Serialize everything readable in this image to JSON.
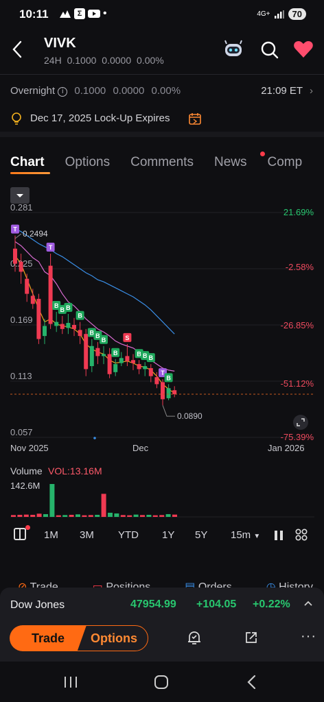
{
  "status": {
    "time": "10:11",
    "network": "4G+",
    "battery": "70"
  },
  "header": {
    "ticker": "VIVK",
    "sub_label": "24H",
    "sub_price": "0.1000",
    "sub_change": "0.0000",
    "sub_pct": "0.00%"
  },
  "overnight": {
    "label": "Overnight",
    "price": "0.1000",
    "change": "0.0000",
    "pct": "0.00%",
    "time": "21:09 ET"
  },
  "lockup": {
    "text": "Dec 17, 2025 Lock-Up Expires"
  },
  "tabs": [
    "Chart",
    "Options",
    "Comments",
    "News",
    "Comp"
  ],
  "chart": {
    "y_labels": [
      "0.281",
      "0.225",
      "0.169",
      "0.113",
      "0.057"
    ],
    "pct_labels": [
      "21.69%",
      "-2.58%",
      "-26.85%",
      "-51.12%",
      "-75.39%"
    ],
    "x_labels": [
      "Nov 2025",
      "Dec",
      "Jan 2026"
    ],
    "high_marker": "0.2494",
    "low_marker": "0.0890",
    "volume_label": "Volume",
    "volume_value": "VOL:13.16M",
    "volume_max": "142.6M",
    "colors": {
      "up": "#26b36b",
      "down": "#ef3a52",
      "ma1": "#f0a020",
      "ma2": "#d86bd0",
      "ma3": "#3a8ee6"
    }
  },
  "chart_data": {
    "type": "candlestick",
    "ylim": [
      0.057,
      0.281
    ],
    "ma_legend": [],
    "candles": [
      {
        "o": 0.245,
        "c": 0.23,
        "h": 0.258,
        "l": 0.222
      },
      {
        "o": 0.232,
        "c": 0.222,
        "h": 0.24,
        "l": 0.21
      },
      {
        "o": 0.215,
        "c": 0.2,
        "h": 0.22,
        "l": 0.192
      },
      {
        "o": 0.198,
        "c": 0.19,
        "h": 0.205,
        "l": 0.185
      },
      {
        "o": 0.195,
        "c": 0.155,
        "h": 0.2,
        "l": 0.15
      },
      {
        "o": 0.158,
        "c": 0.168,
        "h": 0.175,
        "l": 0.15
      },
      {
        "o": 0.228,
        "c": 0.17,
        "h": 0.24,
        "l": 0.165
      },
      {
        "o": 0.168,
        "c": 0.172,
        "h": 0.182,
        "l": 0.162
      },
      {
        "o": 0.17,
        "c": 0.165,
        "h": 0.178,
        "l": 0.16
      },
      {
        "o": 0.166,
        "c": 0.171,
        "h": 0.18,
        "l": 0.16
      },
      {
        "o": 0.169,
        "c": 0.165,
        "h": 0.176,
        "l": 0.158
      },
      {
        "o": 0.164,
        "c": 0.158,
        "h": 0.172,
        "l": 0.15
      },
      {
        "o": 0.16,
        "c": 0.125,
        "h": 0.165,
        "l": 0.118
      },
      {
        "o": 0.128,
        "c": 0.148,
        "h": 0.155,
        "l": 0.122
      },
      {
        "o": 0.146,
        "c": 0.138,
        "h": 0.152,
        "l": 0.13
      },
      {
        "o": 0.138,
        "c": 0.14,
        "h": 0.148,
        "l": 0.13
      },
      {
        "o": 0.14,
        "c": 0.12,
        "h": 0.146,
        "l": 0.116
      },
      {
        "o": 0.122,
        "c": 0.13,
        "h": 0.135,
        "l": 0.118
      },
      {
        "o": 0.131,
        "c": 0.136,
        "h": 0.142,
        "l": 0.128
      },
      {
        "o": 0.138,
        "c": 0.133,
        "h": 0.15,
        "l": 0.128
      },
      {
        "o": 0.134,
        "c": 0.131,
        "h": 0.14,
        "l": 0.124
      },
      {
        "o": 0.13,
        "c": 0.125,
        "h": 0.134,
        "l": 0.12
      },
      {
        "o": 0.125,
        "c": 0.128,
        "h": 0.132,
        "l": 0.118
      },
      {
        "o": 0.126,
        "c": 0.118,
        "h": 0.13,
        "l": 0.112
      },
      {
        "o": 0.117,
        "c": 0.11,
        "h": 0.122,
        "l": 0.106
      },
      {
        "o": 0.112,
        "c": 0.095,
        "h": 0.115,
        "l": 0.089
      },
      {
        "o": 0.096,
        "c": 0.106,
        "h": 0.11,
        "l": 0.094
      },
      {
        "o": 0.104,
        "c": 0.1,
        "h": 0.108,
        "l": 0.097
      }
    ],
    "ma1": [
      0.238,
      0.23,
      0.215,
      0.2,
      0.185,
      0.172,
      0.175,
      0.17,
      0.168,
      0.167,
      0.165,
      0.16,
      0.15,
      0.145,
      0.142,
      0.14,
      0.134,
      0.131,
      0.132,
      0.133,
      0.131,
      0.128,
      0.127,
      0.124,
      0.118,
      0.11,
      0.105,
      0.101
    ],
    "ma2": [
      0.252,
      0.248,
      0.242,
      0.236,
      0.232,
      0.222,
      0.218,
      0.21,
      0.2,
      0.192,
      0.188,
      0.182,
      0.175,
      0.17,
      0.165,
      0.162,
      0.158,
      0.153,
      0.15,
      0.148,
      0.146,
      0.142,
      0.138,
      0.134,
      0.13,
      0.126,
      0.124,
      0.123
    ],
    "ma3": [
      0.265,
      0.262,
      0.258,
      0.254,
      0.25,
      0.247,
      0.244,
      0.24,
      0.237,
      0.233,
      0.229,
      0.225,
      0.221,
      0.218,
      0.214,
      0.212,
      0.209,
      0.206,
      0.203,
      0.2,
      0.197,
      0.193,
      0.189,
      0.184,
      0.178,
      0.172,
      0.166,
      0.16
    ],
    "signals": [
      {
        "i": 0,
        "t": "T"
      },
      {
        "i": 6,
        "t": "T"
      },
      {
        "i": 7,
        "t": "B"
      },
      {
        "i": 8,
        "t": "B"
      },
      {
        "i": 9,
        "t": "B"
      },
      {
        "i": 11,
        "t": "B"
      },
      {
        "i": 13,
        "t": "B"
      },
      {
        "i": 14,
        "t": "B"
      },
      {
        "i": 15,
        "t": "B"
      },
      {
        "i": 17,
        "t": "B"
      },
      {
        "i": 19,
        "t": "S"
      },
      {
        "i": 21,
        "t": "B"
      },
      {
        "i": 22,
        "t": "B"
      },
      {
        "i": 23,
        "t": "B"
      },
      {
        "i": 25,
        "t": "T"
      },
      {
        "i": 26,
        "t": "B"
      }
    ],
    "volume": [
      {
        "v": 8,
        "up": false
      },
      {
        "v": 9,
        "up": false
      },
      {
        "v": 10,
        "up": false
      },
      {
        "v": 9,
        "up": false
      },
      {
        "v": 14,
        "up": false
      },
      {
        "v": 12,
        "up": true
      },
      {
        "v": 142.6,
        "up": true
      },
      {
        "v": 7,
        "up": false
      },
      {
        "v": 8,
        "up": true
      },
      {
        "v": 9,
        "up": false
      },
      {
        "v": 11,
        "up": true
      },
      {
        "v": 7,
        "up": false
      },
      {
        "v": 8,
        "up": false
      },
      {
        "v": 9,
        "up": true
      },
      {
        "v": 100,
        "up": false
      },
      {
        "v": 18,
        "up": true
      },
      {
        "v": 15,
        "up": true
      },
      {
        "v": 8,
        "up": false
      },
      {
        "v": 7,
        "up": false
      },
      {
        "v": 10,
        "up": true
      },
      {
        "v": 8,
        "up": false
      },
      {
        "v": 9,
        "up": true
      },
      {
        "v": 7,
        "up": false
      },
      {
        "v": 8,
        "up": false
      },
      {
        "v": 12,
        "up": true
      },
      {
        "v": 10,
        "up": false
      }
    ]
  },
  "ranges": [
    "1M",
    "3M",
    "YTD",
    "1Y",
    "5Y",
    "15m"
  ],
  "bottom_tabs": [
    "Trade",
    "Positions",
    "Orders",
    "History"
  ],
  "index": {
    "name": "Dow Jones",
    "price": "47954.99",
    "change": "+104.05",
    "pct": "+0.22%"
  },
  "actions": {
    "trade": "Trade",
    "options": "Options"
  }
}
